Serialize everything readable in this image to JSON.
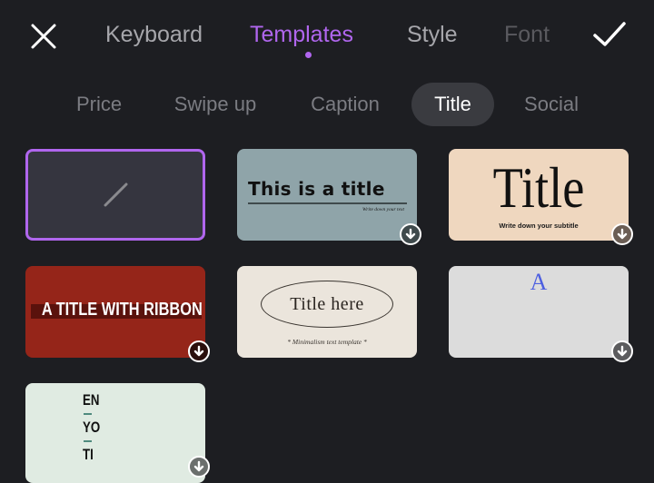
{
  "topbar": {
    "close_icon": "close-icon",
    "confirm_icon": "checkmark-icon",
    "tabs": [
      {
        "label": "Keyboard",
        "active": false
      },
      {
        "label": "Templates",
        "active": true
      },
      {
        "label": "Style",
        "active": false
      },
      {
        "label": "Font",
        "active": false
      }
    ]
  },
  "categories": [
    {
      "label": "Price",
      "active": false
    },
    {
      "label": "Swipe up",
      "active": false
    },
    {
      "label": "Caption",
      "active": false
    },
    {
      "label": "Title",
      "active": true
    },
    {
      "label": "Social",
      "active": false
    }
  ],
  "templates": [
    {
      "name": "none",
      "selected": true,
      "icon": "none-slash-icon"
    },
    {
      "name": "this-is-a-title",
      "title": "This is a title",
      "subtitle": "Write down your text",
      "bg": "#8fa4a9",
      "download_icon": "download-icon"
    },
    {
      "name": "title-serif",
      "title": "Title",
      "subtitle": "Write down your subtitle",
      "bg": "#efd7bf",
      "download_icon": "download-icon"
    },
    {
      "name": "title-with-ribbon",
      "title": "A TITLE WITH RIBBON",
      "bg": "#952519",
      "ribbon": "#5a120c",
      "download_icon": "download-icon"
    },
    {
      "name": "title-here",
      "title": "Title here",
      "subtitle": "* Minimalism text template *",
      "bg": "#ebe5dc"
    },
    {
      "name": "letter-a",
      "title": "A",
      "bg": "#dcdcdc",
      "accent": "#4d5fe0",
      "download_icon": "download-icon"
    },
    {
      "name": "stacked",
      "lines": [
        "EN",
        "YO",
        "TI"
      ],
      "bg": "#e0ebe2",
      "accent": "#4f8a7e",
      "download_icon": "download-icon"
    }
  ],
  "colors": {
    "accent": "#b066ee",
    "background": "#1d1e22"
  }
}
